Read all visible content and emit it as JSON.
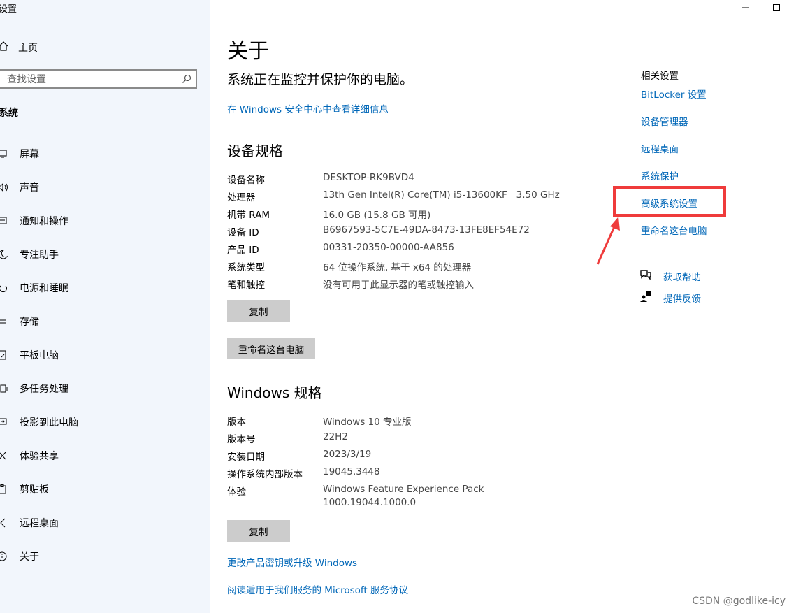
{
  "window": {
    "title": "设置"
  },
  "sidebar": {
    "home_label": "主页",
    "search_placeholder": "查找设置",
    "section_title": "系统",
    "items": [
      {
        "label": "屏幕",
        "icon": "monitor-icon"
      },
      {
        "label": "声音",
        "icon": "speaker-icon"
      },
      {
        "label": "通知和操作",
        "icon": "notification-icon"
      },
      {
        "label": "专注助手",
        "icon": "moon-icon"
      },
      {
        "label": "电源和睡眠",
        "icon": "power-icon"
      },
      {
        "label": "存储",
        "icon": "storage-icon"
      },
      {
        "label": "平板电脑",
        "icon": "tablet-icon"
      },
      {
        "label": "多任务处理",
        "icon": "multitask-icon"
      },
      {
        "label": "投影到此电脑",
        "icon": "projector-icon"
      },
      {
        "label": "体验共享",
        "icon": "share-icon"
      },
      {
        "label": "剪贴板",
        "icon": "clipboard-icon"
      },
      {
        "label": "远程桌面",
        "icon": "remote-icon"
      },
      {
        "label": "关于",
        "icon": "info-icon"
      }
    ]
  },
  "main": {
    "title": "关于",
    "protect_text": "系统正在监控并保护你的电脑。",
    "security_link": "在 Windows 安全中心中查看详细信息",
    "device_specs": {
      "title": "设备规格",
      "rows": [
        {
          "key": "设备名称",
          "value": "DESKTOP-RK9BVD4"
        },
        {
          "key": "处理器",
          "value": "13th Gen Intel(R) Core(TM) i5-13600KF   3.50 GHz"
        },
        {
          "key": "机带 RAM",
          "value": "16.0 GB (15.8 GB 可用)"
        },
        {
          "key": "设备 ID",
          "value": "B6967593-5C7E-49DA-8473-13FE8EF54E72"
        },
        {
          "key": "产品 ID",
          "value": "00331-20350-00000-AA856"
        },
        {
          "key": "系统类型",
          "value": "64 位操作系统, 基于 x64 的处理器"
        },
        {
          "key": "笔和触控",
          "value": "没有可用于此显示器的笔或触控输入"
        }
      ],
      "copy_button": "复制",
      "rename_button": "重命名这台电脑"
    },
    "windows_specs": {
      "title": "Windows 规格",
      "rows": [
        {
          "key": "版本",
          "value": "Windows 10 专业版"
        },
        {
          "key": "版本号",
          "value": "22H2"
        },
        {
          "key": "安装日期",
          "value": "2023/3/19"
        },
        {
          "key": "操作系统内部版本",
          "value": "19045.3448"
        },
        {
          "key": "体验",
          "value": "Windows Feature Experience Pack",
          "value2": "1000.19044.1000.0"
        }
      ],
      "copy_button": "复制"
    },
    "links": [
      "更改产品密钥或升级 Windows",
      "阅读适用于我们服务的 Microsoft 服务协议"
    ]
  },
  "related": {
    "title": "相关设置",
    "links": [
      "BitLocker 设置",
      "设备管理器",
      "远程桌面",
      "系统保护",
      "高级系统设置",
      "重命名这台电脑"
    ],
    "help": "获取帮助",
    "feedback": "提供反馈"
  },
  "colors": {
    "link": "#0067b8",
    "highlight": "#ef3b3b",
    "sidebar_bg": "#f2f6fc"
  },
  "watermark": "CSDN @godlike-icy"
}
